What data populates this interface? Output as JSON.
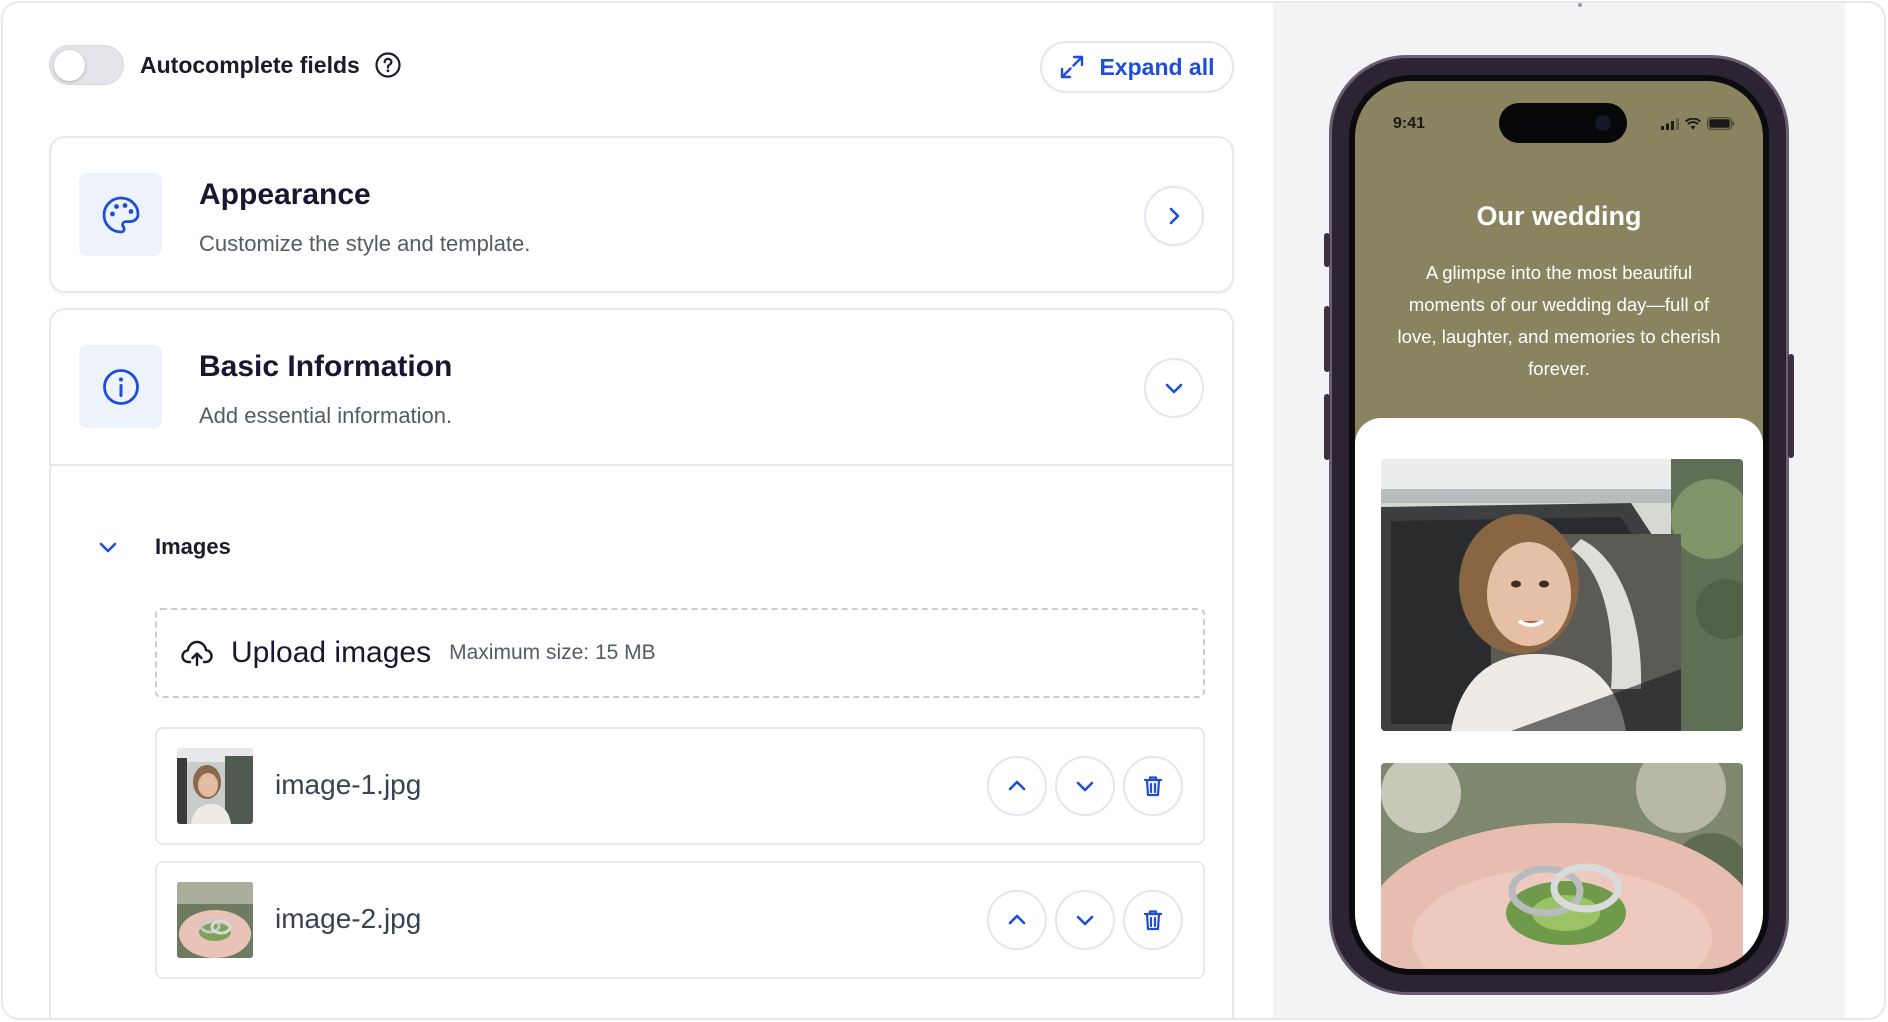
{
  "editor": {
    "autocomplete": {
      "label": "Autocomplete fields",
      "enabled": false
    },
    "expand_all_label": "Expand all",
    "sections": {
      "appearance": {
        "title": "Appearance",
        "subtitle": "Customize the style and template."
      },
      "basic": {
        "title": "Basic Information",
        "subtitle": "Add essential information."
      }
    },
    "images": {
      "label": "Images",
      "upload_label": "Upload images",
      "upload_hint": "Maximum size: 15 MB",
      "files": [
        {
          "name": "image-1.jpg"
        },
        {
          "name": "image-2.jpg"
        }
      ]
    }
  },
  "preview": {
    "time": "9:41",
    "title": "Our wedding",
    "description": "A glimpse into the most beautiful moments of our wedding day—full of love, laughter, and memories to cherish forever.",
    "background_color": "#8a8360"
  },
  "colors": {
    "accent": "#1d4ed8",
    "icon_tile_bg": "#eef2fb",
    "border": "#e7e8ee"
  }
}
